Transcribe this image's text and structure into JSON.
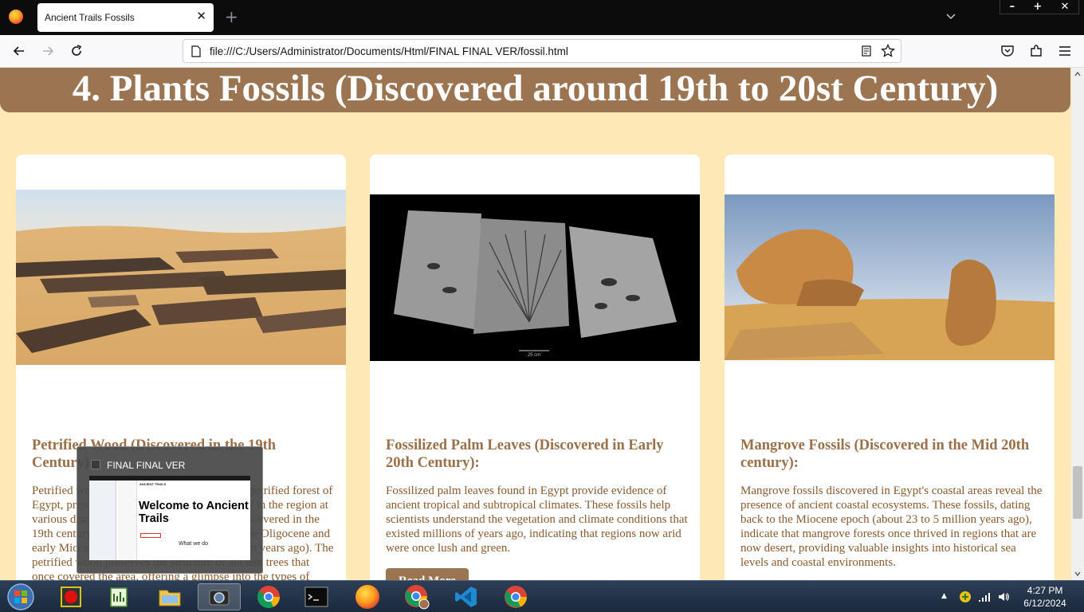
{
  "browser": {
    "tab_title": "Ancient Trails Fossils",
    "url": "file:///C:/Users/Administrator/Documents/Html/FINAL FINAL VER/fossil.html"
  },
  "page": {
    "heading": "4. Plants Fossils (Discovered around 19th to 20st Century)",
    "cards": [
      {
        "title": "Petrified Wood (Discovered in the 19th Century):",
        "text": "Petrified wood found in the Western Desert's petrified forest of Egypt, preserving ancient trees that once grew in the region at various discovery sites. These fossils were discovered in the 19th century. These fossils date back to the late Oligocene and early Miocene epochs (around 30 to 20 million years ago). The petrified wood preserves the structure of ancient trees that once covered the area, offering a glimpse into the types of trees",
        "image_alt": "Petrified wood logs in the desert"
      },
      {
        "title": "Fossilized Palm Leaves (Discovered in Early 20th Century):",
        "text": "Fossilized palm leaves found in Egypt provide evidence of ancient tropical and subtropical climates. These fossils help scientists understand the vegetation and climate conditions that existed millions of years ago, indicating that regions now arid were once lush and green.",
        "button": "Read More",
        "image_alt": "Fossilized palm leaf slabs",
        "scale_label": "25 cm"
      },
      {
        "title": "Mangrove Fossils (Discovered in the Mid 20th century):",
        "text": "Mangrove fossils discovered in Egypt's coastal areas reveal the presence of ancient coastal ecosystems. These fossils, dating back to the Miocene epoch (about 23 to 5 million years ago), indicate that mangrove forests once thrived in regions that are now desert, providing valuable insights into historical sea levels and coastal environments.",
        "image_alt": "Mangrove fossil rocks in desert"
      }
    ]
  },
  "thumbnail_popup": {
    "title": "FINAL FINAL VER",
    "preview_small": "ANCIENT TRAILS",
    "preview_heading": "Welcome to Ancient Trails",
    "preview_sub": "What we do"
  },
  "taskbar": {
    "apps": [
      "record-app",
      "editor-app",
      "file-explorer",
      "camera-app",
      "chrome",
      "terminal",
      "firefox",
      "chrome-profile",
      "vscode",
      "chrome-2"
    ],
    "time": "4:27 PM",
    "date": "6/12/2024"
  },
  "colors": {
    "page_bg": "#fde8b6",
    "accent_brown": "#9b7452",
    "title_brown": "#9b6f47",
    "text_brown": "#8a5a2e"
  }
}
